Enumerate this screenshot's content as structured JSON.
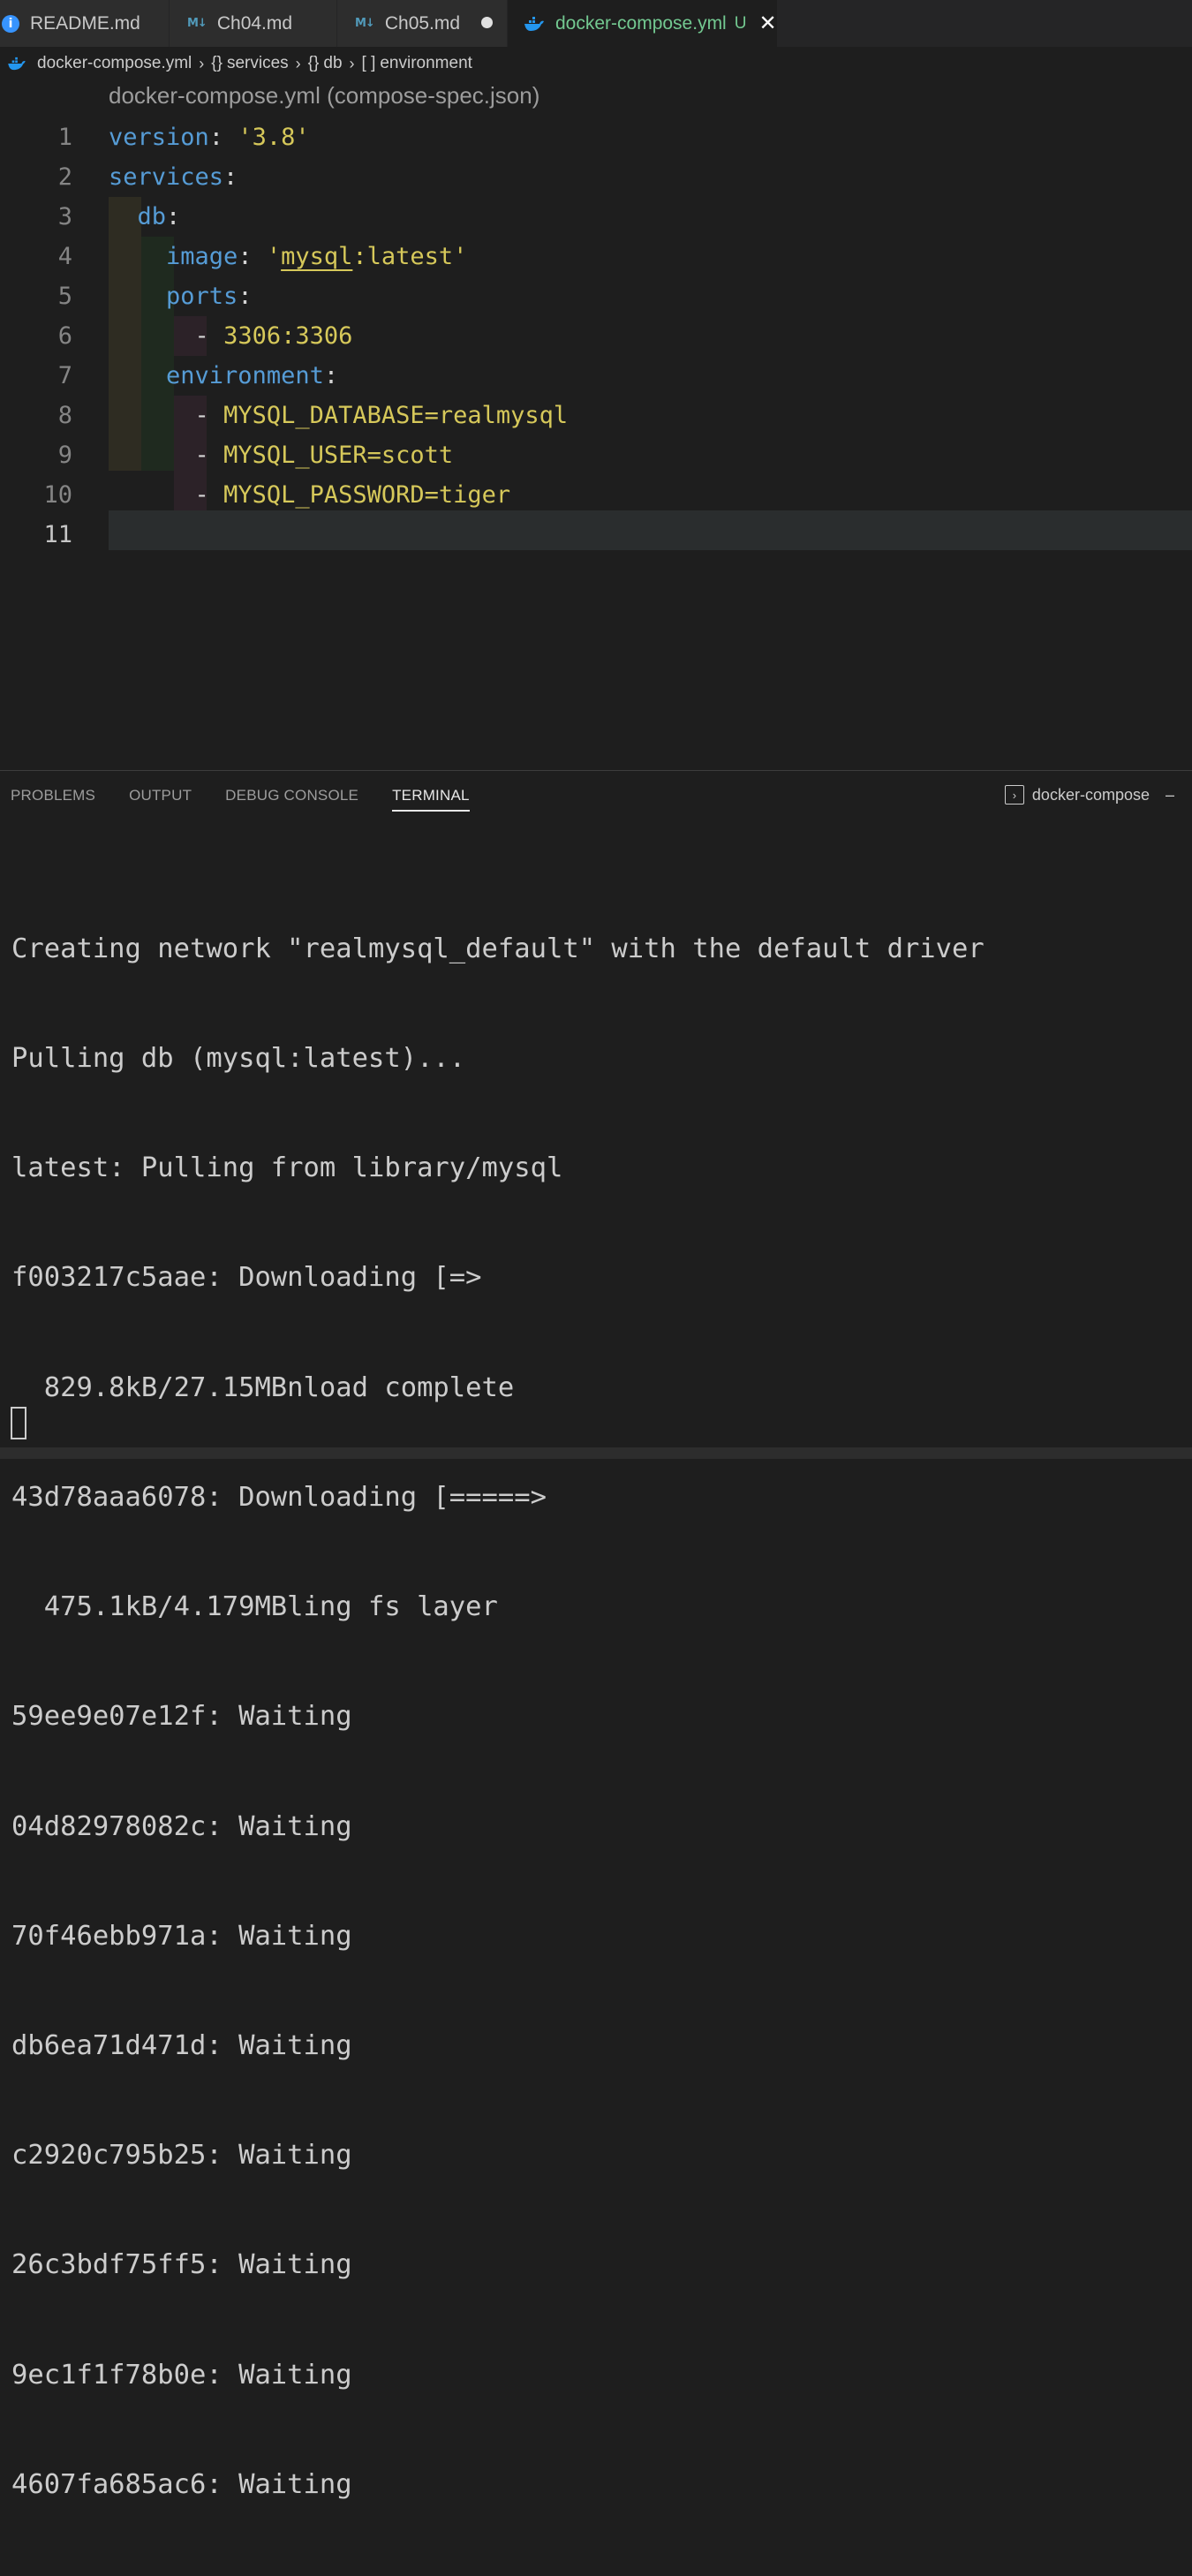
{
  "tabs": [
    {
      "label": "README.md",
      "icon": "info-icon"
    },
    {
      "label": "Ch04.md",
      "icon": "markdown-icon"
    },
    {
      "label": "Ch05.md",
      "icon": "markdown-icon",
      "dirty": true
    },
    {
      "label": "docker-compose.yml",
      "icon": "docker-icon",
      "badge": "U",
      "close": "✕",
      "active": true
    }
  ],
  "breadcrumb": {
    "file": "docker-compose.yml",
    "items": [
      "services",
      "db",
      "environment"
    ],
    "symbols": [
      "{}",
      "{}",
      "[ ]"
    ],
    "separator": "›"
  },
  "editor": {
    "schema_hint": "docker-compose.yml (compose-spec.json)",
    "current_line": 11,
    "lines": [
      {
        "n": "1"
      },
      {
        "n": "2"
      },
      {
        "n": "3"
      },
      {
        "n": "4"
      },
      {
        "n": "5"
      },
      {
        "n": "6"
      },
      {
        "n": "7"
      },
      {
        "n": "8"
      },
      {
        "n": "9"
      },
      {
        "n": "10"
      },
      {
        "n": "11"
      }
    ],
    "tokens": {
      "l1_key": "version",
      "l1_val": "'3.8'",
      "l2_key": "services",
      "l3_key": "db",
      "l4_key": "image",
      "l4_q1": "'",
      "l4_under": "mysql",
      "l4_rest": ":latest'",
      "l5_key": "ports",
      "l6_dash": "- ",
      "l6_val": "3306:3306",
      "l7_key": "environment",
      "l8_dash": "- ",
      "l8_val": "MYSQL_DATABASE=realmysql",
      "l9_dash": "- ",
      "l9_val": "MYSQL_USER=scott",
      "l10_dash": "- ",
      "l10_val": "MYSQL_PASSWORD=tiger",
      "colon": ":"
    }
  },
  "panel": {
    "tabs": [
      "PROBLEMS",
      "OUTPUT",
      "DEBUG CONSOLE",
      "TERMINAL"
    ],
    "active_tab": "TERMINAL",
    "terminal_name": "docker-compose"
  },
  "terminal": {
    "lines": [
      "Creating network \"realmysql_default\" with the default driver",
      "Pulling db (mysql:latest)...",
      "latest: Pulling from library/mysql",
      "f003217c5aae: Downloading [=>",
      "  829.8kB/27.15MBnload complete",
      "43d78aaa6078: Downloading [=====>",
      "  475.1kB/4.179MBling fs layer",
      "59ee9e07e12f: Waiting",
      "04d82978082c: Waiting",
      "70f46ebb971a: Waiting",
      "db6ea71d471d: Waiting",
      "c2920c795b25: Waiting",
      "26c3bdf75ff5: Waiting",
      "9ec1f1f78b0e: Waiting",
      "4607fa685ac6: Waiting"
    ]
  },
  "colors": {
    "accent_modified": "#73c991",
    "yaml_key": "#569cd6",
    "yaml_value": "#d6c85a"
  }
}
